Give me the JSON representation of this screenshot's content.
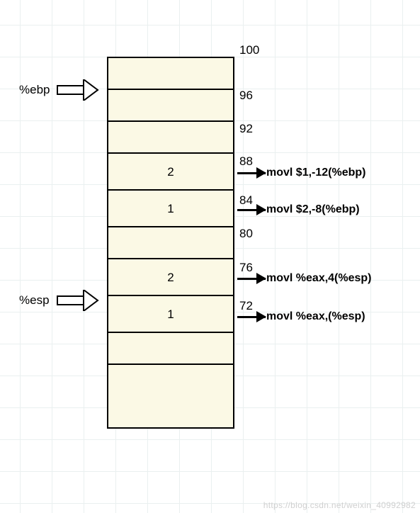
{
  "pointers": {
    "ebp": "%ebp",
    "esp": "%esp"
  },
  "addresses": {
    "a100": "100",
    "a96": "96",
    "a92": "92",
    "a88": "88",
    "a84": "84",
    "a80": "80",
    "a76": "76",
    "a72": "72"
  },
  "stack_cells": {
    "c0": "",
    "c1": "",
    "c2": "",
    "c3": "2",
    "c4": "1",
    "c5": "",
    "c6": "2",
    "c7": "1",
    "c8": "",
    "c9": ""
  },
  "instructions": {
    "i1": "movl $1,-12(%ebp)",
    "i2": "movl $2,-8(%ebp)",
    "i3": "movl %eax,4(%esp)",
    "i4": "movl %eax,(%esp)"
  },
  "watermark": "https://blog.csdn.net/weixin_40992982",
  "chart_data": {
    "type": "table",
    "title": "Stack frame layout with register pointers and mov instructions",
    "pointers": [
      {
        "register": "%ebp",
        "points_to_address": 96
      },
      {
        "register": "%esp",
        "points_to_address": 72
      }
    ],
    "cells": [
      {
        "top_address": 100,
        "bottom_address": 96,
        "content": ""
      },
      {
        "top_address": 96,
        "bottom_address": 92,
        "content": ""
      },
      {
        "top_address": 92,
        "bottom_address": 88,
        "content": ""
      },
      {
        "top_address": 88,
        "bottom_address": 84,
        "content": "2",
        "instruction": "movl $1,-12(%ebp)"
      },
      {
        "top_address": 84,
        "bottom_address": 80,
        "content": "1",
        "instruction": "movl $2,-8(%ebp)"
      },
      {
        "top_address": 80,
        "bottom_address": 76,
        "content": ""
      },
      {
        "top_address": 76,
        "bottom_address": 72,
        "content": "2",
        "instruction": "movl %eax,4(%esp)"
      },
      {
        "top_address": 72,
        "bottom_address": null,
        "content": "1",
        "instruction": "movl %eax,(%esp)"
      },
      {
        "top_address": null,
        "bottom_address": null,
        "content": ""
      },
      {
        "top_address": null,
        "bottom_address": null,
        "content": ""
      }
    ]
  }
}
